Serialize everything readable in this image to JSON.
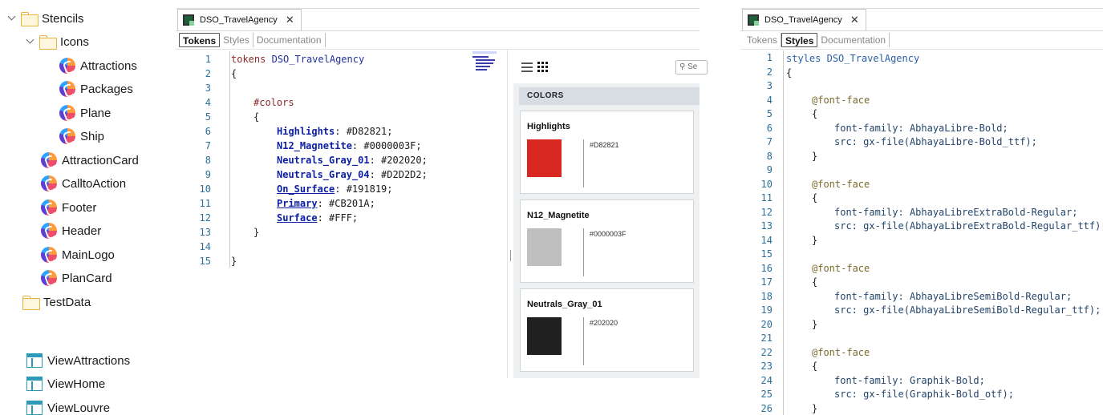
{
  "tree": {
    "stencils": "Stencils",
    "icons": "Icons",
    "attractions": "Attractions",
    "packages": "Packages",
    "plane": "Plane",
    "ship": "Ship",
    "attraction_card": "AttractionCard",
    "call_to_action": "CalltoAction",
    "footer": "Footer",
    "header": "Header",
    "main_logo": "MainLogo",
    "plan_card": "PlanCard",
    "test_data": "TestData",
    "view_attractions": "ViewAttractions",
    "view_home": "ViewHome",
    "view_louvre": "ViewLouvre"
  },
  "tokens_editor": {
    "tab_title": "DSO_TravelAgency",
    "tab_close": "✕",
    "subtabs": [
      "Tokens",
      "Styles",
      "Documentation"
    ],
    "line_numbers": [
      "1",
      "2",
      "3",
      "4",
      "5",
      "6",
      "7",
      "8",
      "9",
      "10",
      "11",
      "12",
      "13",
      "14",
      "15"
    ],
    "code": {
      "l1_kw": "tokens",
      "l1_name": "DSO_TravelAgency",
      "l2": "{",
      "l4": "#colors",
      "l5": "{",
      "rows": [
        {
          "name": "Highlights",
          "value": "#D82821;"
        },
        {
          "name": "N12_Magnetite",
          "value": "#0000003F;"
        },
        {
          "name": "Neutrals_Gray_01",
          "value": "#202020;"
        },
        {
          "name": "Neutrals_Gray_04",
          "value": "#D2D2D2;"
        },
        {
          "name": "On_Surface",
          "value": "#191819;"
        },
        {
          "name": "Primary",
          "value": "#CB201A;"
        },
        {
          "name": "Surface",
          "value": "#FFF;"
        }
      ],
      "l13": "}",
      "l15": "}"
    }
  },
  "preview": {
    "search_placeholder": "Se",
    "section_header": "COLORS",
    "cards": [
      {
        "name": "Highlights",
        "hex": "#D82821",
        "color": "#D82821"
      },
      {
        "name": "N12_Magnetite",
        "hex": "#0000003F",
        "color": "#BFBFBF"
      },
      {
        "name": "Neutrals_Gray_01",
        "hex": "#202020",
        "color": "#202020"
      }
    ]
  },
  "styles_editor": {
    "tab_title": "DSO_TravelAgency",
    "tab_close": "✕",
    "subtabs": [
      "Tokens",
      "Styles",
      "Documentation"
    ],
    "line_numbers": [
      "1",
      "2",
      "3",
      "4",
      "5",
      "6",
      "7",
      "8",
      "9",
      "10",
      "11",
      "12",
      "13",
      "14",
      "15",
      "16",
      "17",
      "18",
      "19",
      "20",
      "21",
      "22",
      "23",
      "24",
      "25",
      "26"
    ],
    "code": {
      "l1_kw": "styles",
      "l1_name": "DSO_TravelAgency",
      "open": "{",
      "close": "}",
      "at_rule": "@font-face",
      "font_family_label": "font-family:",
      "src_label": "src:",
      "faces": [
        {
          "family": "AbhayaLibre-Bold;",
          "src": "gx-file(AbhayaLibre-Bold_ttf);"
        },
        {
          "family": "AbhayaLibreExtraBold-Regular;",
          "src": "gx-file(AbhayaLibreExtraBold-Regular_ttf);"
        },
        {
          "family": "AbhayaLibreSemiBold-Regular;",
          "src": "gx-file(AbhayaLibreSemiBold-Regular_ttf);"
        },
        {
          "family": "Graphik-Bold;",
          "src": "gx-file(Graphik-Bold_otf);"
        }
      ]
    }
  },
  "colors": {
    "accent_tab_border": "#555555",
    "line_number": "#2b6f9a",
    "folder": "#e6b33c"
  }
}
